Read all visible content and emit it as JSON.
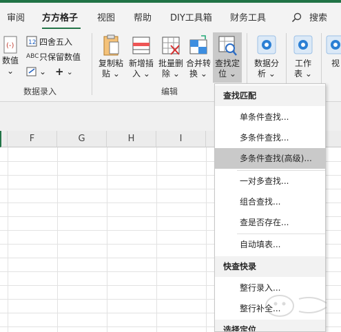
{
  "colors": {
    "accent": "#217346",
    "highlight": "#c9c9c9"
  },
  "tabs": [
    {
      "label": "审阅"
    },
    {
      "label": "方方格子"
    },
    {
      "label": "视图"
    },
    {
      "label": "帮助"
    },
    {
      "label": "DIY工具箱"
    },
    {
      "label": "财务工具"
    },
    {
      "label": "搜索"
    }
  ],
  "ribbon": {
    "data_entry": {
      "numeric": "数值",
      "round": "四舍五入",
      "keep_numeric": "只保留数值",
      "group_label": "数据录入"
    },
    "edit": {
      "copy_paste": [
        "复制粘",
        "贴"
      ],
      "add_insert": [
        "新增插",
        "入"
      ],
      "batch_delete": [
        "批量删",
        "除"
      ],
      "merge_convert": [
        "合并转",
        "换"
      ],
      "find_locate": [
        "查找定",
        "位"
      ],
      "group_label": "编辑"
    },
    "data_analysis": [
      "数据分",
      "析"
    ],
    "worksheet": [
      "工作",
      "表"
    ],
    "view_partial": "视"
  },
  "grid": {
    "columns": [
      "F",
      "G",
      "H",
      "I"
    ]
  },
  "menu": {
    "sections": [
      {
        "title": "查找匹配",
        "items": [
          "单条件查找...",
          "多条件查找...",
          "多条件查找(高级)...",
          "一对多查找...",
          "组合查找...",
          "查是否存在...",
          "自动填表..."
        ]
      },
      {
        "title": "快查快录",
        "items": [
          "整行录入...",
          "整行补全..."
        ]
      },
      {
        "title": "选择定位",
        "items": []
      }
    ],
    "highlighted_item": "多条件查找(高级)..."
  }
}
